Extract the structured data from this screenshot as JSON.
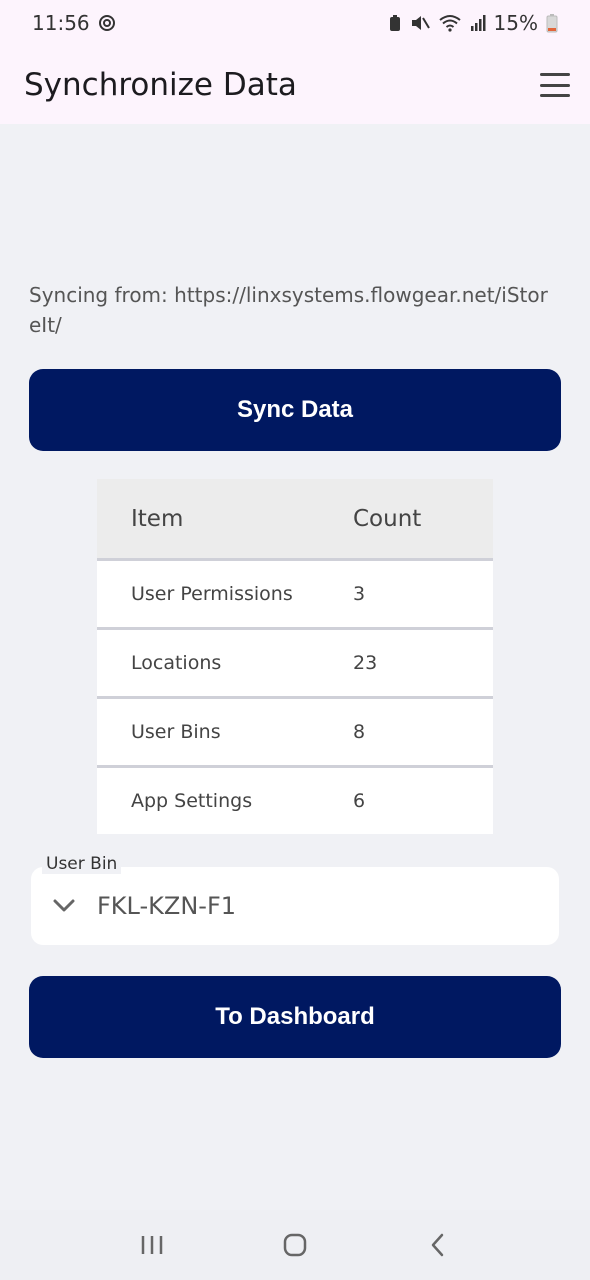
{
  "status_bar": {
    "time": "11:56",
    "battery": "15%"
  },
  "app_bar": {
    "title": "Synchronize Data",
    "menu_icon": "hamburger-menu-icon"
  },
  "sync": {
    "prefix": "Syncing from: ",
    "url": "https://linxsystems.flowgear.net/iStoreIt/",
    "button_label": "Sync Data"
  },
  "table": {
    "headers": [
      "Item",
      "Count"
    ],
    "rows": [
      {
        "item": "User Permissions",
        "count": "3"
      },
      {
        "item": "Locations",
        "count": "23"
      },
      {
        "item": "User Bins",
        "count": "8"
      },
      {
        "item": "App Settings",
        "count": "6"
      }
    ]
  },
  "user_bin": {
    "label": "User Bin",
    "value": "FKL-KZN-F1",
    "icon": "chevron-down-icon"
  },
  "dashboard_button": {
    "label": "To Dashboard"
  },
  "colors": {
    "primary": "#001861",
    "appbar_bg": "#fdf4fd",
    "page_bg": "#f0f1f5"
  }
}
